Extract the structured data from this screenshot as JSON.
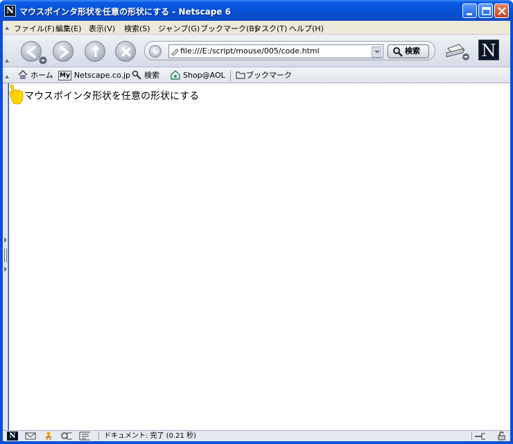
{
  "window": {
    "title": "マウスポインタ形状を任意の形状にする - Netscape 6",
    "app_icon": "N"
  },
  "menu": {
    "items": [
      {
        "label": "ファイル(F)",
        "x_hint": "file"
      },
      {
        "label": "編集(E)",
        "x_hint": "edit"
      },
      {
        "label": "表示(V)",
        "x_hint": "view"
      },
      {
        "label": "検索(S)",
        "x_hint": "search"
      },
      {
        "label": "ジャンプ(G)",
        "x_hint": "go"
      },
      {
        "label": "ブックマーク(B)",
        "x_hint": "bookmarks"
      },
      {
        "label": "タスク(T)",
        "x_hint": "tasks"
      },
      {
        "label": "ヘルプ(H)",
        "x_hint": "help"
      }
    ]
  },
  "navigation": {
    "url": "file:///E:/script/mouse/005/code.html",
    "search_label": "検索",
    "logo": "N"
  },
  "personal_toolbar": {
    "items": [
      {
        "label": "ホーム",
        "icon": "home-icon"
      },
      {
        "label": "Netscape.co.jp",
        "icon": "my-icon"
      },
      {
        "label": "検索",
        "icon": "search-icon"
      },
      {
        "label": "Shop@AOL",
        "icon": "shop-icon"
      },
      {
        "label": "ブックマーク",
        "icon": "folder-icon"
      }
    ],
    "my_badge": "My"
  },
  "content": {
    "text": "マウスポインタ形状を任意の形状にする"
  },
  "status": {
    "text": "ドキュメント: 完了 (0.21 秒)"
  },
  "colors": {
    "titlebar": "#0651d4",
    "cursor": "#ffd700"
  }
}
